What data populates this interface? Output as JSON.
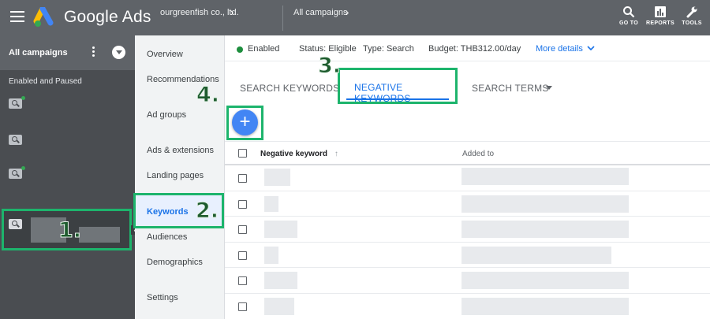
{
  "header": {
    "brand": "Google Ads",
    "account": "ourgreenfish co., ltd.",
    "breadcrumb": "All campaigns",
    "tools": [
      {
        "label": "GO TO",
        "icon": "search-icon"
      },
      {
        "label": "REPORTS",
        "icon": "reports-icon"
      },
      {
        "label": "TOOLS",
        "icon": "wrench-icon"
      }
    ]
  },
  "sidebar": {
    "title": "All campaigns",
    "filter_label": "Enabled and Paused"
  },
  "annotations": {
    "step1": "1.",
    "step2": "2.",
    "step3": "3.",
    "step4": "4."
  },
  "page_menu": {
    "items": [
      "Overview",
      "Recommendations",
      "Ad groups",
      "Ads & extensions",
      "Landing pages",
      "Keywords",
      "Audiences",
      "Demographics",
      "Settings"
    ],
    "active": "Keywords"
  },
  "status_bar": {
    "status_chip": "Enabled",
    "status": "Status: Eligible",
    "type": "Type: Search",
    "budget": "Budget: THB312.00/day",
    "more_details": "More details"
  },
  "tabs": {
    "search_keywords": "SEARCH KEYWORDS",
    "negative_keywords": "NEGATIVE KEYWORDS",
    "search_terms": "SEARCH TERMS"
  },
  "add_button": "+",
  "table": {
    "columns": [
      "Negative keyword",
      "Added to"
    ],
    "sort_indicator": "↑"
  },
  "colors": {
    "topbar": "#5f6368",
    "highlight": "#1db46c",
    "accent": "#1a73e8",
    "fab": "#4285f4"
  }
}
